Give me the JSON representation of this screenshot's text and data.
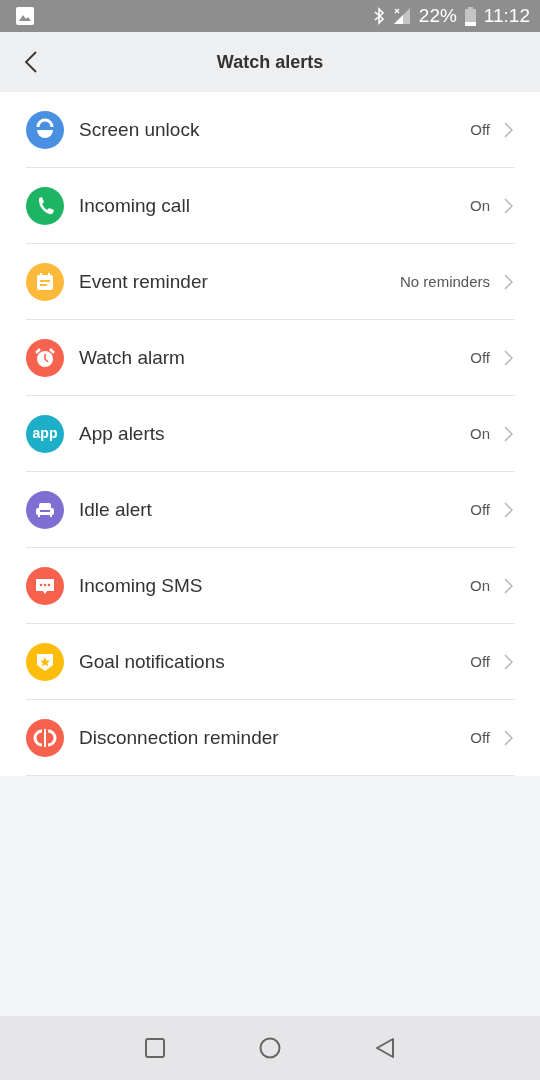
{
  "status_bar": {
    "battery": "22%",
    "time": "11:12"
  },
  "header": {
    "title": "Watch alerts"
  },
  "items": [
    {
      "label": "Screen unlock",
      "value": "Off",
      "kind": "unlock",
      "color": "#4a90e2"
    },
    {
      "label": "Incoming call",
      "value": "On",
      "kind": "phone",
      "color": "#1db464"
    },
    {
      "label": "Event reminder",
      "value": "No reminders",
      "kind": "calendar",
      "color": "#fdb93a"
    },
    {
      "label": "Watch alarm",
      "value": "Off",
      "kind": "alarm",
      "color": "#f7624e"
    },
    {
      "label": "App alerts",
      "value": "On",
      "kind": "text",
      "icon_text": "app",
      "color": "#1eafc8"
    },
    {
      "label": "Idle alert",
      "value": "Off",
      "kind": "sofa",
      "color": "#7f6fd2"
    },
    {
      "label": "Incoming SMS",
      "value": "On",
      "kind": "message",
      "color": "#f7624e"
    },
    {
      "label": "Goal notifications",
      "value": "Off",
      "kind": "badge",
      "color": "#fdbd0a"
    },
    {
      "label": "Disconnection reminder",
      "value": "Off",
      "kind": "disconnect",
      "color": "#f7624e"
    }
  ]
}
